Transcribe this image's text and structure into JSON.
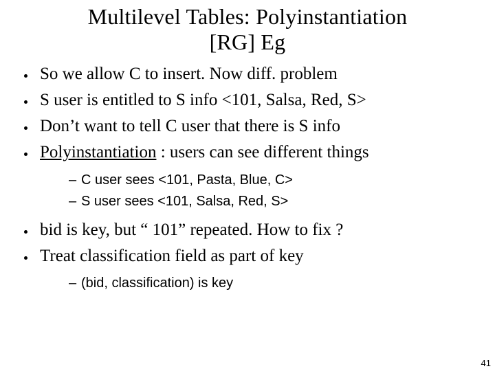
{
  "title_line1": "Multilevel Tables: Polyinstantiation",
  "title_line2": "[RG] Eg",
  "b1": "So we allow C to insert. Now diff. problem",
  "b2": "S user is entitled to S info <101, Salsa, Red, S>",
  "b3": "Don’t want to tell C user that there is S info",
  "b4_term": "Polyinstantiation",
  "b4_rest": " : users can see different things",
  "s1": "C user sees <101, Pasta, Blue, C>",
  "s2": "S user sees <101, Salsa, Red, S>",
  "b5": "bid is key, but “ 101” repeated. How to fix ?",
  "b6": "Treat classification field as part of key",
  "s3": "(bid, classification) is key",
  "page": "41"
}
